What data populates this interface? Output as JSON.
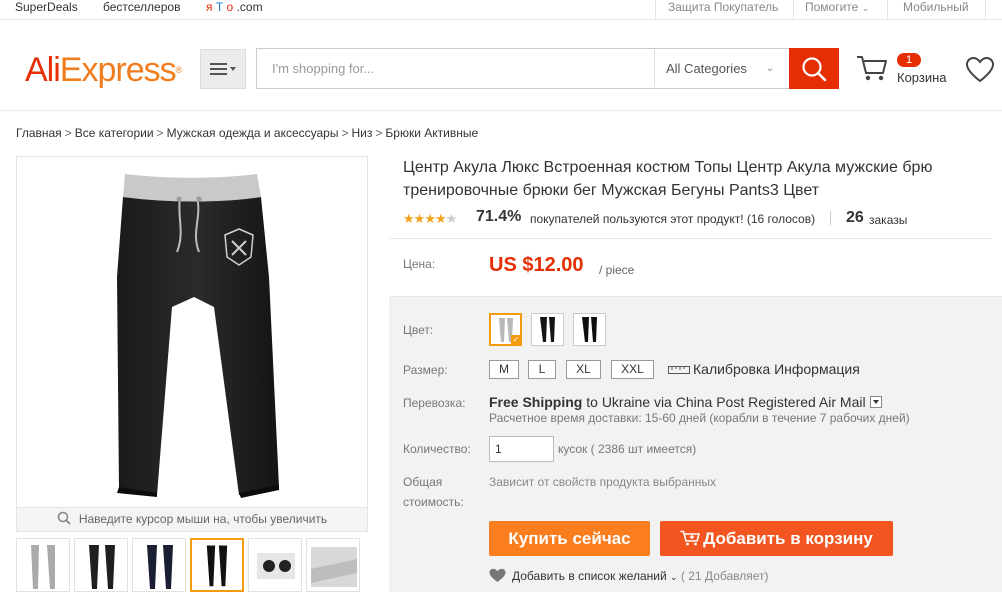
{
  "topbar": {
    "left_links": [
      "SuperDeals",
      "бестселлеров"
    ],
    "brand_ya": "я",
    "brand_t": "Т",
    "brand_o": "о",
    "brand_com": ".com",
    "right_links": [
      "Защита Покупатель",
      "Помогите",
      "Мобильный"
    ]
  },
  "header": {
    "logo_ali": "Ali",
    "logo_express": "Express",
    "logo_tm": "®",
    "search_placeholder": "I'm shopping for...",
    "category_select": "All Categories",
    "cart_count": "1",
    "cart_label": "Корзина"
  },
  "breadcrumb": [
    "Главная",
    "Все категории",
    "Мужская одежда и аксессуары",
    "Низ",
    "Брюки Активные"
  ],
  "product": {
    "title_line1": "Центр Акула Люкс Встроенная костюм Топы Центр Акула мужские брю",
    "title_line2": "тренировочные брюки бег Мужская Бегуны Pants3 Цвет",
    "rating_stars": 4,
    "rating_percent": "71.4%",
    "rating_text": "покупателей пользуются этот продукт! (16 голосов)",
    "orders_count": "26",
    "orders_label": "заказы",
    "price_label": "Цена:",
    "price": "US $12.00",
    "price_unit": "/ piece",
    "zoom_hint": "Наведите курсор мыши на, чтобы увеличить"
  },
  "options": {
    "color_label": "Цвет:",
    "color_swatches": [
      "light-gray-pants",
      "black-pants",
      "black-pants-2"
    ],
    "size_label": "Размер:",
    "sizes": [
      "M",
      "L",
      "XL",
      "XXL"
    ],
    "calibration_label": "Калибровка Информация",
    "shipping_label": "Перевозка:",
    "shipping_free": "Free Shipping",
    "shipping_to": "to",
    "shipping_dest": "Ukraine via China Post Registered Air Mail",
    "shipping_time": "Расчетное время доставки: 15-60 дней (корабли в течение 7 рабочих дней)",
    "quantity_label": "Количество:",
    "quantity_value": "1",
    "quantity_note": "кусок ( 2386 шт имеется)",
    "total_label_1": "Общая",
    "total_label_2": "стоимость:",
    "total_note": "Зависит от свойств продукта выбранных"
  },
  "actions": {
    "buy_now": "Купить сейчас",
    "add_to_cart": "Добавить в корзину",
    "wishlist": "Добавить в список желаний",
    "wishlist_count": "( 21 Добавляет)"
  },
  "colors": {
    "brand_red": "#e62e04",
    "buy_orange": "#fa7d1e",
    "cart_orange": "#f2551f",
    "selected_border": "#f39c12",
    "star": "#f4a11b"
  }
}
